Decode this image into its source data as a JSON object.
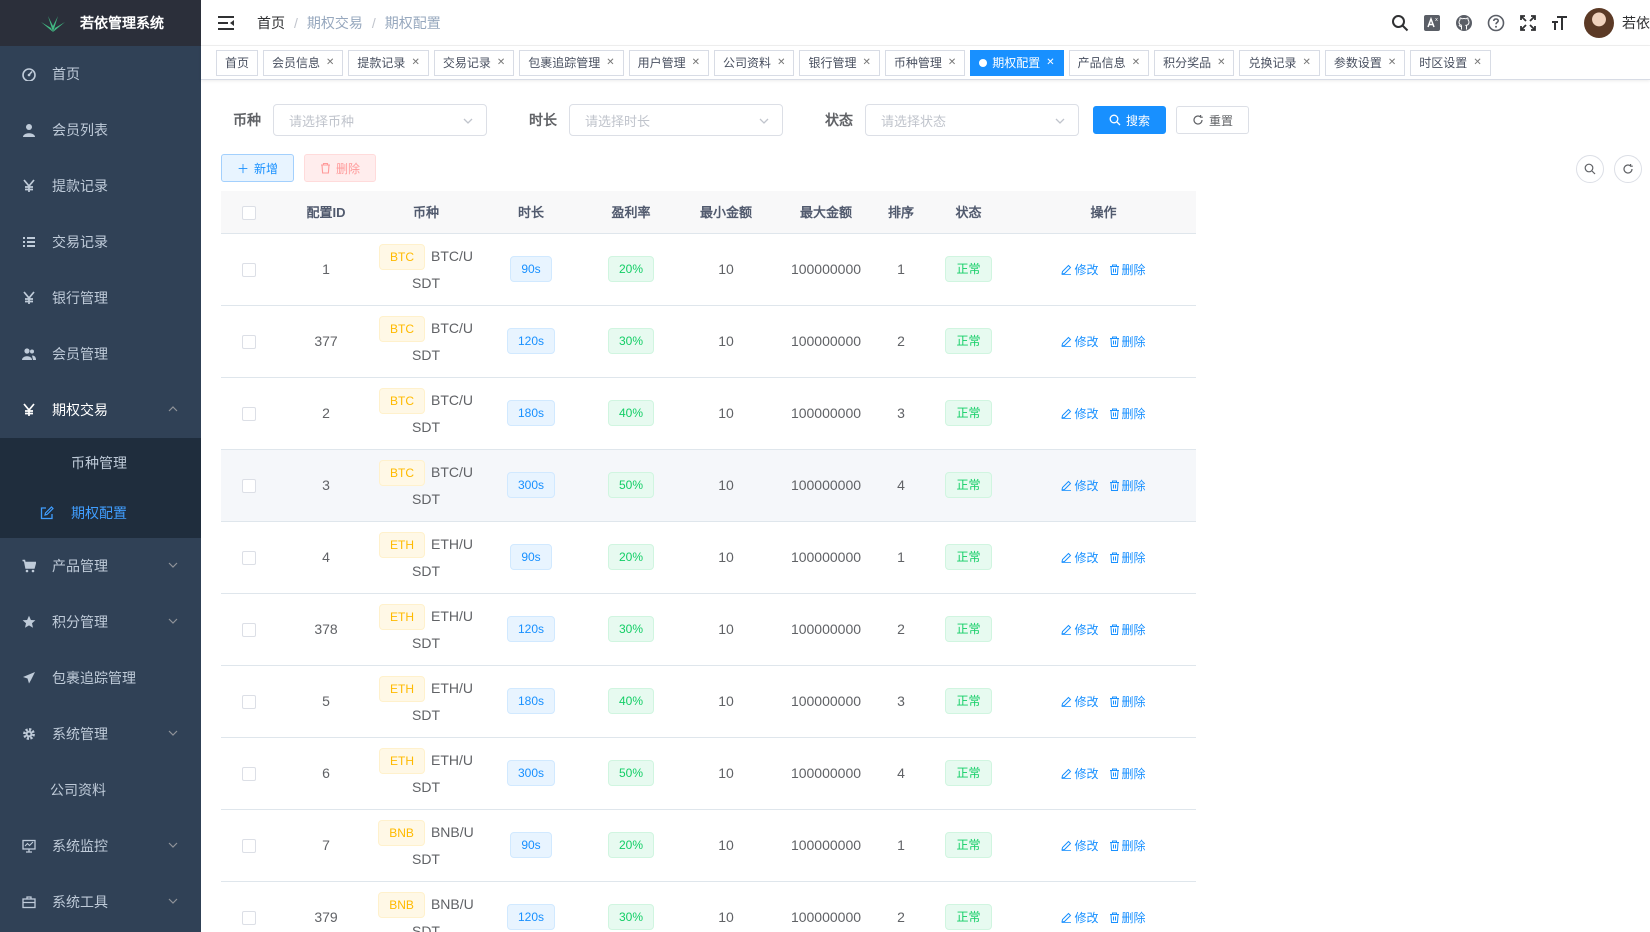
{
  "app": {
    "title": "若依管理系统"
  },
  "sidebar": {
    "items": [
      {
        "label": "首页",
        "icon": "dashboard-icon"
      },
      {
        "label": "会员列表",
        "icon": "user-icon"
      },
      {
        "label": "提款记录",
        "icon": "yen-icon"
      },
      {
        "label": "交易记录",
        "icon": "list-icon"
      },
      {
        "label": "银行管理",
        "icon": "yen-icon"
      },
      {
        "label": "会员管理",
        "icon": "peoples-icon"
      },
      {
        "label": "期权交易",
        "icon": "yen-icon",
        "open": true
      },
      {
        "label": "币种管理"
      },
      {
        "label": "期权配置",
        "icon": "edit-icon",
        "active": true
      },
      {
        "label": "产品管理",
        "icon": "cart-icon"
      },
      {
        "label": "积分管理",
        "icon": "star-icon"
      },
      {
        "label": "包裹追踪管理",
        "icon": "send-icon"
      },
      {
        "label": "系统管理",
        "icon": "gear-icon"
      },
      {
        "label": "公司资料"
      },
      {
        "label": "系统监控",
        "icon": "monitor-icon"
      },
      {
        "label": "系统工具",
        "icon": "tool-icon"
      }
    ]
  },
  "breadcrumb": [
    "首页",
    "期权交易",
    "期权配置"
  ],
  "navbar": {
    "username": "若依"
  },
  "tags": [
    {
      "label": "首页",
      "closable": false
    },
    {
      "label": "会员信息",
      "closable": true
    },
    {
      "label": "提款记录",
      "closable": true
    },
    {
      "label": "交易记录",
      "closable": true
    },
    {
      "label": "包裹追踪管理",
      "closable": true
    },
    {
      "label": "用户管理",
      "closable": true
    },
    {
      "label": "公司资料",
      "closable": true
    },
    {
      "label": "银行管理",
      "closable": true
    },
    {
      "label": "币种管理",
      "closable": true
    },
    {
      "label": "期权配置",
      "closable": true,
      "active": true
    },
    {
      "label": "产品信息",
      "closable": true
    },
    {
      "label": "积分奖品",
      "closable": true
    },
    {
      "label": "兑换记录",
      "closable": true
    },
    {
      "label": "参数设置",
      "closable": true
    },
    {
      "label": "时区设置",
      "closable": true
    }
  ],
  "search": {
    "coin_label": "币种",
    "coin_placeholder": "请选择币种",
    "duration_label": "时长",
    "duration_placeholder": "请选择时长",
    "status_label": "状态",
    "status_placeholder": "请选择状态",
    "search_btn": "搜索",
    "reset_btn": "重置"
  },
  "toolbar": {
    "add_label": "新增",
    "delete_label": "删除"
  },
  "table": {
    "columns": [
      "配置ID",
      "币种",
      "时长",
      "盈利率",
      "最小金额",
      "最大金额",
      "排序",
      "状态",
      "操作"
    ],
    "edit_label": "修改",
    "delete_label": "删除",
    "rows": [
      {
        "id": "1",
        "coin": "BTC",
        "pair": "BTC/USDT",
        "duration": "90s",
        "rate": "20%",
        "min": "10",
        "max": "100000000",
        "sort": "1",
        "status": "正常"
      },
      {
        "id": "377",
        "coin": "BTC",
        "pair": "BTC/USDT",
        "duration": "120s",
        "rate": "30%",
        "min": "10",
        "max": "100000000",
        "sort": "2",
        "status": "正常"
      },
      {
        "id": "2",
        "coin": "BTC",
        "pair": "BTC/USDT",
        "duration": "180s",
        "rate": "40%",
        "min": "10",
        "max": "100000000",
        "sort": "3",
        "status": "正常"
      },
      {
        "id": "3",
        "coin": "BTC",
        "pair": "BTC/USDT",
        "duration": "300s",
        "rate": "50%",
        "min": "10",
        "max": "100000000",
        "sort": "4",
        "status": "正常"
      },
      {
        "id": "4",
        "coin": "ETH",
        "pair": "ETH/USDT",
        "duration": "90s",
        "rate": "20%",
        "min": "10",
        "max": "100000000",
        "sort": "1",
        "status": "正常"
      },
      {
        "id": "378",
        "coin": "ETH",
        "pair": "ETH/USDT",
        "duration": "120s",
        "rate": "30%",
        "min": "10",
        "max": "100000000",
        "sort": "2",
        "status": "正常"
      },
      {
        "id": "5",
        "coin": "ETH",
        "pair": "ETH/USDT",
        "duration": "180s",
        "rate": "40%",
        "min": "10",
        "max": "100000000",
        "sort": "3",
        "status": "正常"
      },
      {
        "id": "6",
        "coin": "ETH",
        "pair": "ETH/USDT",
        "duration": "300s",
        "rate": "50%",
        "min": "10",
        "max": "100000000",
        "sort": "4",
        "status": "正常"
      },
      {
        "id": "7",
        "coin": "BNB",
        "pair": "BNB/USDT",
        "duration": "90s",
        "rate": "20%",
        "min": "10",
        "max": "100000000",
        "sort": "1",
        "status": "正常"
      },
      {
        "id": "379",
        "coin": "BNB",
        "pair": "BNB/USDT",
        "duration": "120s",
        "rate": "30%",
        "min": "10",
        "max": "100000000",
        "sort": "2",
        "status": "正常"
      }
    ]
  },
  "colors": {
    "sidebar_bg": "#304156",
    "primary": "#1890ff",
    "success": "#13ce66",
    "warning": "#ffba00"
  }
}
